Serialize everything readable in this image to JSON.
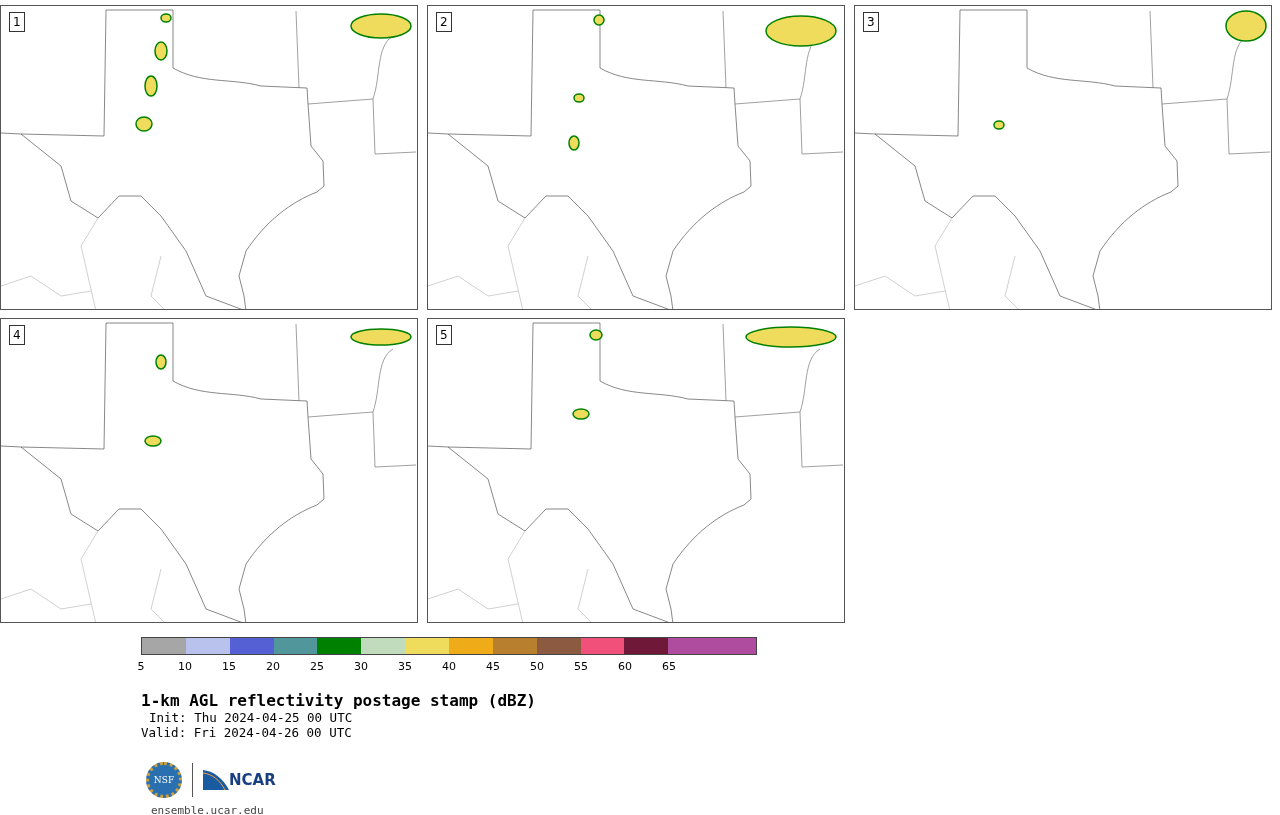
{
  "panels": [
    {
      "number": "1"
    },
    {
      "number": "2"
    },
    {
      "number": "3"
    },
    {
      "number": "4"
    },
    {
      "number": "5"
    }
  ],
  "colorbar": {
    "bins": [
      {
        "color": "#a6a6a6",
        "label": "5"
      },
      {
        "color": "#b8c2ec",
        "label": "10"
      },
      {
        "color": "#5560d4",
        "label": "15"
      },
      {
        "color": "#50969a",
        "label": "20"
      },
      {
        "color": "#008000",
        "label": "25"
      },
      {
        "color": "#c0dcbc",
        "label": "30"
      },
      {
        "color": "#f0dc5c",
        "label": "35"
      },
      {
        "color": "#f0ac18",
        "label": "40"
      },
      {
        "color": "#b8802e",
        "label": "45"
      },
      {
        "color": "#8c5a40",
        "label": "50"
      },
      {
        "color": "#f0507a",
        "label": "55"
      },
      {
        "color": "#701838",
        "label": "60"
      },
      {
        "color": "#b04ca0",
        "label": "65"
      },
      {
        "color": "#b04ca0"
      }
    ]
  },
  "title": "1-km AGL reflectivity postage stamp (dBZ)",
  "init": "Init: Thu 2024-04-25 00 UTC",
  "valid": "Valid: Fri 2024-04-26 00 UTC",
  "logos": {
    "nsf": "NSF",
    "ncar": "NCAR"
  },
  "site": "ensemble.ucar.edu"
}
